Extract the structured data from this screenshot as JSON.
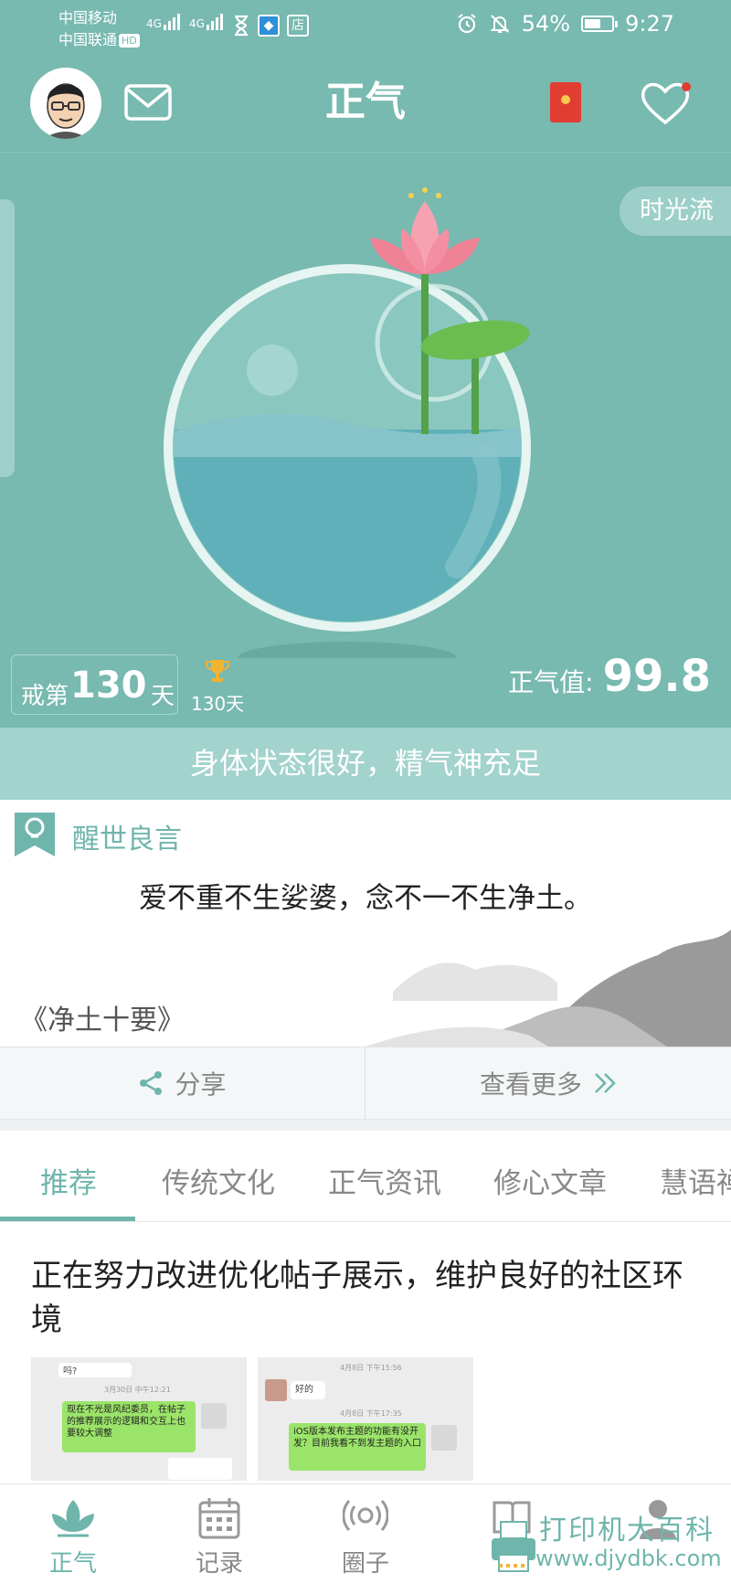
{
  "status_bar": {
    "carrier1": "中国移动",
    "carrier2": "中国联通",
    "hd": "HD",
    "signal1": "4G",
    "signal2": "4G",
    "shop_icon_char": "店",
    "battery": "54%",
    "time": "9:27"
  },
  "header": {
    "title": "正气"
  },
  "hero": {
    "timeflow_label": "时光流",
    "streak_prefix": "戒第",
    "streak_days": "130",
    "streak_suffix": "天",
    "record_days": "130天",
    "zhengqi_label": "正气值:",
    "zhengqi_value": "99.8",
    "status_text": "身体状态很好，精气神充足"
  },
  "quote": {
    "header": "醒世良言",
    "text": "爱不重不生娑婆，念不一不生净土。",
    "source": "《净土十要》"
  },
  "actions": {
    "share": "分享",
    "more": "查看更多"
  },
  "tabs": [
    {
      "label": "推荐"
    },
    {
      "label": "传统文化"
    },
    {
      "label": "正气资讯"
    },
    {
      "label": "修心文章"
    },
    {
      "label": "慧语禅"
    }
  ],
  "post": {
    "title": "正在努力改进优化帖子展示，维护良好的社区环境"
  },
  "shot1": {
    "bubble_top": "吗?",
    "time": "3月30日 中午12:21",
    "green_text": "现在不光是风纪委员，在帖子的推荐展示的逻辑和交互上也要较大调整"
  },
  "shot2": {
    "time1": "4月8日 下午15:56",
    "bubble": "好的",
    "time2": "4月8日 下午17:35",
    "green_text": "iOS版本发布主题的功能有没开发？目前我看不到发主题的入口"
  },
  "bottom_nav": [
    {
      "label": "正气",
      "icon": "lotus-icon"
    },
    {
      "label": "记录",
      "icon": "calendar-icon"
    },
    {
      "label": "圈子",
      "icon": "broadcast-icon"
    },
    {
      "label": "",
      "icon": "book-icon"
    },
    {
      "label": "",
      "icon": "profile-icon"
    }
  ],
  "watermark": {
    "line1": "打印机大百科",
    "line2": "www.djydbk.com"
  },
  "colors": {
    "hero_bg": "#78b9b0",
    "accent": "#6fb5ac",
    "red": "#e23d32"
  }
}
